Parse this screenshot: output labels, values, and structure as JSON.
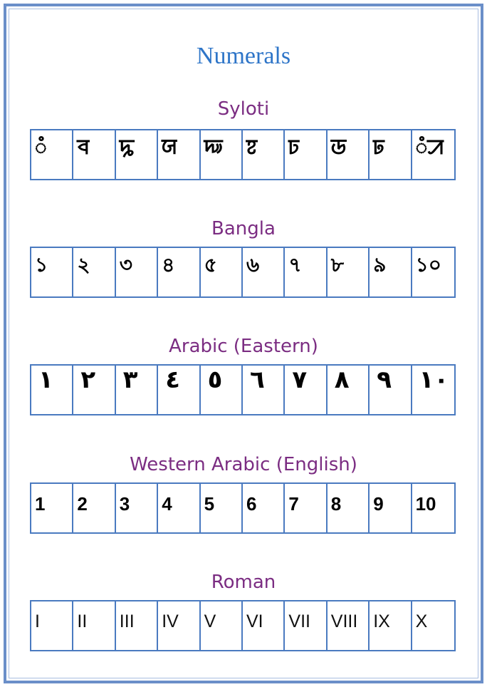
{
  "title": "Numerals",
  "sections": [
    {
      "name": "Syloti",
      "values": [
        "ꠋ",
        "ꠌ",
        "ꠍ",
        "ꠎ",
        "ꠏ",
        "ꠐ",
        "ꠑ",
        "ꠒ",
        "ꠓ",
        "ꠋꠀ"
      ]
    },
    {
      "name": "Bangla",
      "values": [
        "১",
        "২",
        "৩",
        "৪",
        "৫",
        "৬",
        "৭",
        "৮",
        "৯",
        "১০"
      ]
    },
    {
      "name": "Arabic (Eastern)",
      "values": [
        "١",
        "٢",
        "٣",
        "٤",
        "٥",
        "٦",
        "٧",
        "٨",
        "٩",
        "١٠"
      ]
    },
    {
      "name": "Western Arabic (English)",
      "values": [
        "1",
        "2",
        "3",
        "4",
        "5",
        "6",
        "7",
        "8",
        "9",
        "10"
      ]
    },
    {
      "name": "Roman",
      "values": [
        "I",
        "II",
        "III",
        "IV",
        "V",
        "VI",
        "VII",
        "VIII",
        "IX",
        "X"
      ]
    }
  ],
  "colors": {
    "title": "#2e75c8",
    "section_title": "#7b2d82",
    "border": "#4a7ac0"
  }
}
